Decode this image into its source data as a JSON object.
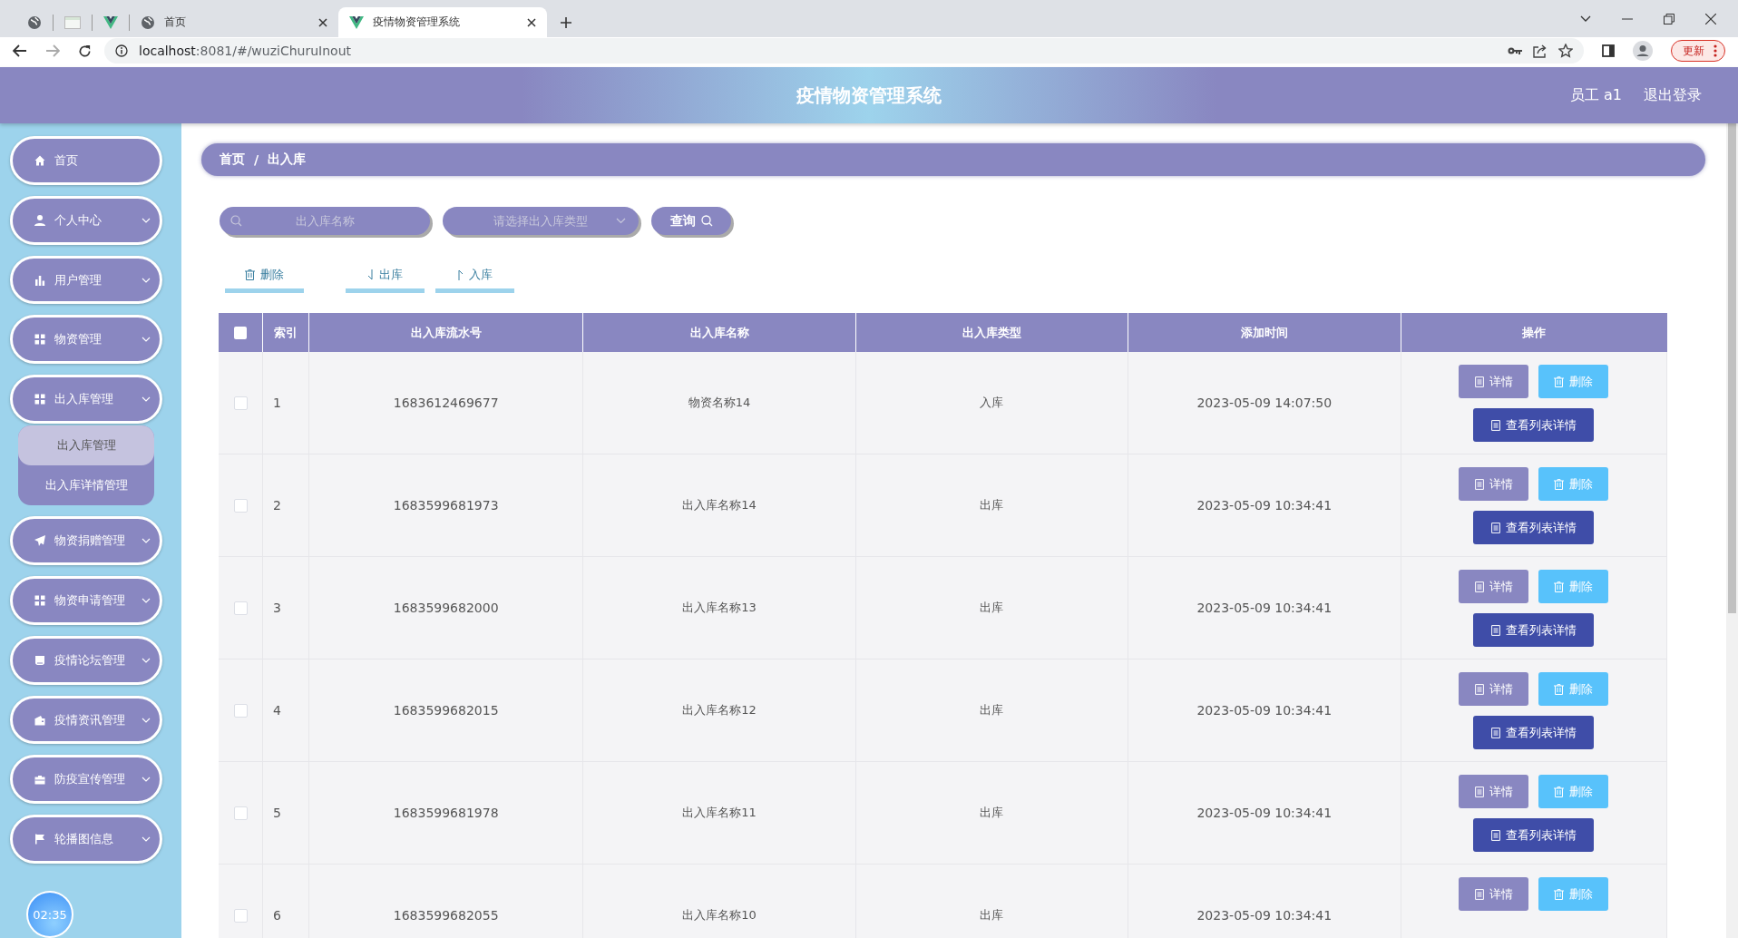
{
  "browser": {
    "tabs": [
      {
        "kind": "globe",
        "selected": false
      },
      {
        "kind": "blank",
        "selected": false
      },
      {
        "kind": "vue",
        "selected": false
      },
      {
        "kind": "globe",
        "title": "首页",
        "selected": false
      },
      {
        "kind": "vue",
        "title": "疫情物资管理系统",
        "selected": true
      }
    ],
    "url_host": "localhost",
    "url_rest": ":8081/#/wuziChuruInout",
    "update_button": "更新"
  },
  "header": {
    "title": "疫情物资管理系统",
    "user": "员工 a1",
    "logout": "退出登录"
  },
  "sidebar": {
    "items": [
      {
        "label": "首页",
        "kind": "home",
        "has_submenu": false
      },
      {
        "label": "个人中心",
        "kind": "user",
        "has_submenu": true
      },
      {
        "label": "用户管理",
        "kind": "bars",
        "has_submenu": true
      },
      {
        "label": "物资管理",
        "kind": "grid",
        "has_submenu": true
      },
      {
        "label": "出入库管理",
        "kind": "grid",
        "has_submenu": true,
        "children": [
          {
            "label": "出入库管理",
            "selected": true
          },
          {
            "label": "出入库详情管理",
            "selected": false
          }
        ]
      },
      {
        "label": "物资捐赠管理",
        "kind": "send",
        "has_submenu": true
      },
      {
        "label": "物资申请管理",
        "kind": "grid",
        "has_submenu": true
      },
      {
        "label": "疫情论坛管理",
        "kind": "tray",
        "has_submenu": true
      },
      {
        "label": "疫情资讯管理",
        "kind": "wallet",
        "has_submenu": true
      },
      {
        "label": "防疫宣传管理",
        "kind": "briefcase",
        "has_submenu": true
      },
      {
        "label": "轮播图信息",
        "kind": "flag",
        "has_submenu": true
      }
    ],
    "clock": "02:35"
  },
  "breadcrumb": {
    "items": [
      "首页",
      "出入库"
    ],
    "separator": "/"
  },
  "search": {
    "name_placeholder": "出入库名称",
    "type_placeholder": "请选择出入库类型",
    "query_button": "查询"
  },
  "toolbar": [
    {
      "label": "删除",
      "kind": "trash"
    },
    {
      "label": "出库",
      "kind": "down"
    },
    {
      "label": "入库",
      "kind": "up"
    }
  ],
  "table": {
    "header_checked": false,
    "columns": [
      "索引",
      "出入库流水号",
      "出入库名称",
      "出入库类型",
      "添加时间",
      "操作"
    ],
    "rows": [
      {
        "checked": false,
        "index": "1",
        "serial": "1683612469677",
        "name": "物资名称14",
        "type": "入库",
        "time": "2023-05-09 14:07:50",
        "actions": [
          "详情",
          "删除",
          "查看列表详情"
        ]
      },
      {
        "checked": false,
        "index": "2",
        "serial": "1683599681973",
        "name": "出入库名称14",
        "type": "出库",
        "time": "2023-05-09 10:34:41",
        "actions": [
          "详情",
          "删除",
          "查看列表详情"
        ]
      },
      {
        "checked": false,
        "index": "3",
        "serial": "1683599682000",
        "name": "出入库名称13",
        "type": "出库",
        "time": "2023-05-09 10:34:41",
        "actions": [
          "详情",
          "删除",
          "查看列表详情"
        ]
      },
      {
        "checked": false,
        "index": "4",
        "serial": "1683599682015",
        "name": "出入库名称12",
        "type": "出库",
        "time": "2023-05-09 10:34:41",
        "actions": [
          "详情",
          "删除",
          "查看列表详情"
        ]
      },
      {
        "checked": false,
        "index": "5",
        "serial": "1683599681978",
        "name": "出入库名称11",
        "type": "出库",
        "time": "2023-05-09 10:34:41",
        "actions": [
          "详情",
          "删除",
          "查看列表详情"
        ]
      },
      {
        "checked": false,
        "index": "6",
        "serial": "1683599682055",
        "name": "出入库名称10",
        "type": "出库",
        "time": "2023-05-09 10:34:41",
        "actions": [
          "详情",
          "删除"
        ]
      }
    ]
  }
}
